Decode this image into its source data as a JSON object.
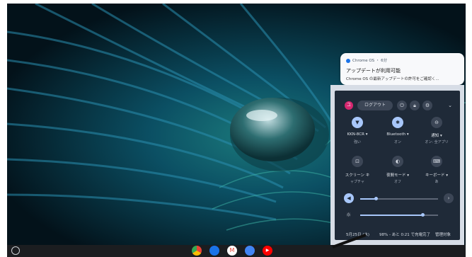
{
  "notification": {
    "source": "Chrome OS ・ 6分",
    "title": "アップデートが利用可能",
    "body": "Chrome OS の最新アップデートの許可をご確認く..."
  },
  "quick_settings": {
    "avatar_initial": "ユ",
    "sign_out_label": "ログアウト",
    "top_icons": [
      "power-icon",
      "lock-icon",
      "gear-icon",
      "chevron-down-icon"
    ],
    "tiles": [
      {
        "label": "KKN-8CR ▾",
        "sub": "強い",
        "icon": "wifi-icon",
        "active": true
      },
      {
        "label": "Bluetooth ▾",
        "sub": "オン",
        "icon": "bluetooth-icon",
        "active": true
      },
      {
        "label": "通知 ▾",
        "sub": "オン: 全アプリ",
        "icon": "do-not-disturb-icon",
        "active": false
      },
      {
        "label": "スクリーン キ",
        "sub": "ャプチャ",
        "icon": "screen-capture-icon",
        "active": false
      },
      {
        "label": "夜間モード ▾",
        "sub": "オフ",
        "icon": "night-light-icon",
        "active": false
      },
      {
        "label": "キーボード ▾",
        "sub": "あ",
        "icon": "keyboard-icon",
        "active": false
      }
    ],
    "volume_level": 0.2,
    "brightness_level": 0.8,
    "date": "5月25日 (水)",
    "battery": "98% - あと 0:21 で充電完了",
    "managed": "管理対象"
  },
  "shelf": {
    "apps": [
      "chrome-icon",
      "files-icon",
      "gmail-icon",
      "docs-icon",
      "youtube-icon"
    ]
  },
  "colors": {
    "accent": "#a8c7fa",
    "panel": "#1f2a38",
    "avatar": "#d6276f"
  }
}
